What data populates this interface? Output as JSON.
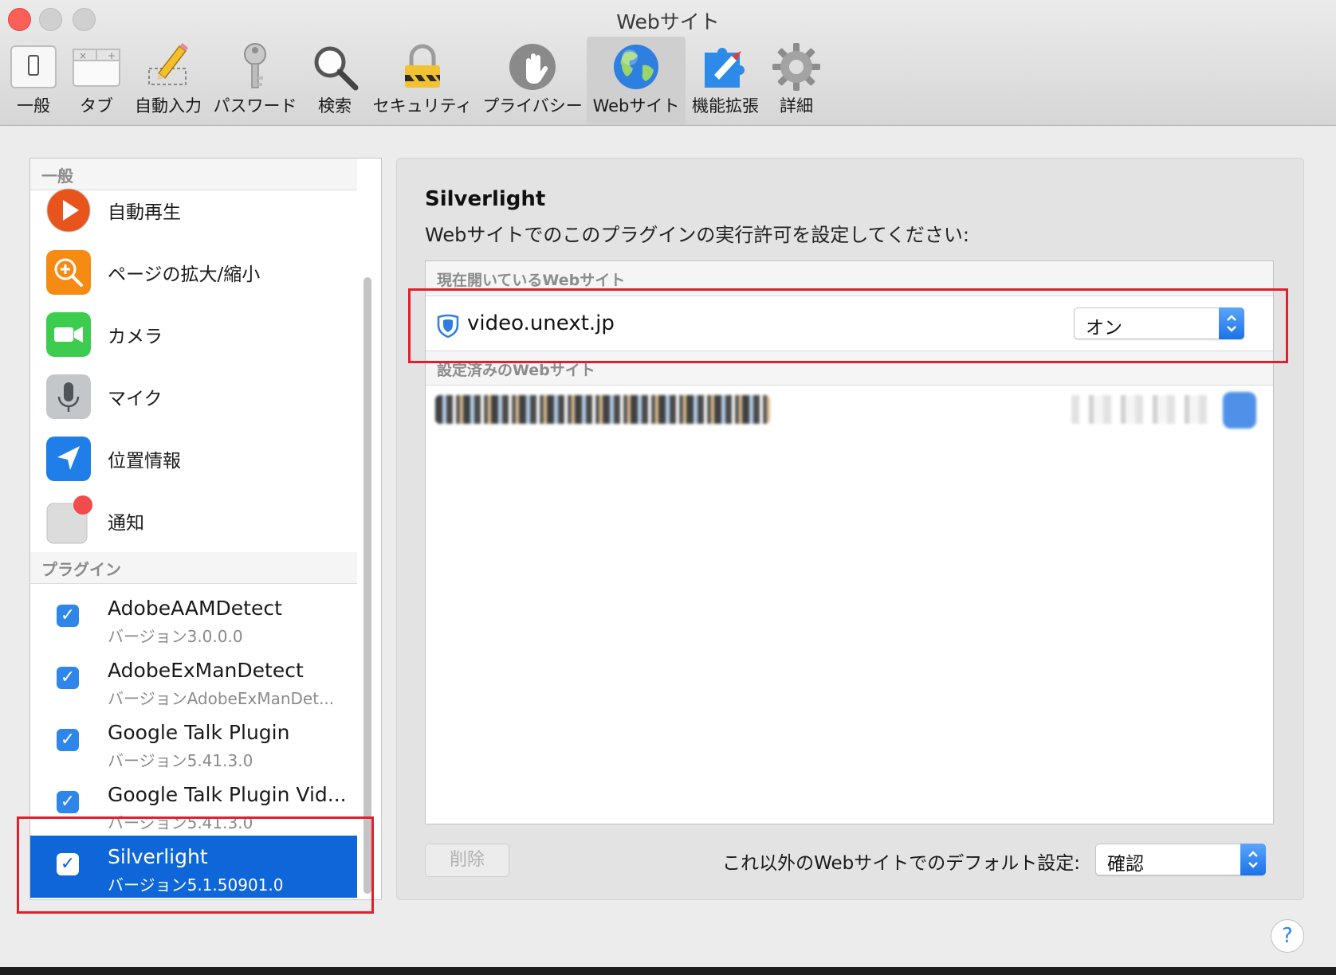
{
  "window": {
    "title": "Webサイト"
  },
  "toolbar": {
    "items": [
      {
        "label": "一般",
        "icon": "switch-icon"
      },
      {
        "label": "タブ",
        "icon": "tabs-icon"
      },
      {
        "label": "自動入力",
        "icon": "pencil-icon"
      },
      {
        "label": "パスワード",
        "icon": "key-icon"
      },
      {
        "label": "検索",
        "icon": "magnifier-icon"
      },
      {
        "label": "セキュリティ",
        "icon": "lock-icon"
      },
      {
        "label": "プライバシー",
        "icon": "hand-icon"
      },
      {
        "label": "Webサイト",
        "icon": "globe-icon",
        "active": true
      },
      {
        "label": "機能拡張",
        "icon": "puzzle-compass-icon"
      },
      {
        "label": "詳細",
        "icon": "gear-icon"
      }
    ]
  },
  "sidebar": {
    "general_header": "一般",
    "general_items": [
      {
        "label": "自動再生",
        "icon": "play-icon",
        "color": "#e8541c"
      },
      {
        "label": "ページの拡大/縮小",
        "icon": "zoom-icon",
        "color": "#f58b13"
      },
      {
        "label": "カメラ",
        "icon": "camera-icon",
        "color": "#3ccd4e"
      },
      {
        "label": "マイク",
        "icon": "microphone-icon",
        "color": "#b7bcc0"
      },
      {
        "label": "位置情報",
        "icon": "location-icon",
        "color": "#1f7ee8"
      },
      {
        "label": "通知",
        "icon": "notification-icon",
        "color": "#d9d9d9"
      }
    ],
    "plugins_header": "プラグイン",
    "plugins": [
      {
        "name": "AdobeAAMDetect",
        "version": "バージョン3.0.0.0",
        "checked": true
      },
      {
        "name": "AdobeExManDetect",
        "version": "バージョンAdobeExManDet...",
        "checked": true
      },
      {
        "name": "Google Talk Plugin",
        "version": "バージョン5.41.3.0",
        "checked": true
      },
      {
        "name": "Google Talk Plugin Vid...",
        "version": "バージョン5.41.3.0",
        "checked": true
      },
      {
        "name": "Silverlight",
        "version": "バージョン5.1.50901.0",
        "checked": true,
        "selected": true
      }
    ]
  },
  "panel": {
    "title": "Silverlight",
    "subtitle": "Webサイトでのこのプラグインの実行許可を設定してください:",
    "current_header": "現在開いているWebサイト",
    "current_site": {
      "name": "video.unext.jp",
      "setting": "オン"
    },
    "configured_header": "設定済みのWebサイト",
    "delete_label": "削除",
    "default_label": "これ以外のWebサイトでのデフォルト設定:",
    "default_value": "確認"
  },
  "help_label": "?",
  "colors": {
    "accent": "#0f66d9",
    "highlight_box": "#e0202e"
  }
}
